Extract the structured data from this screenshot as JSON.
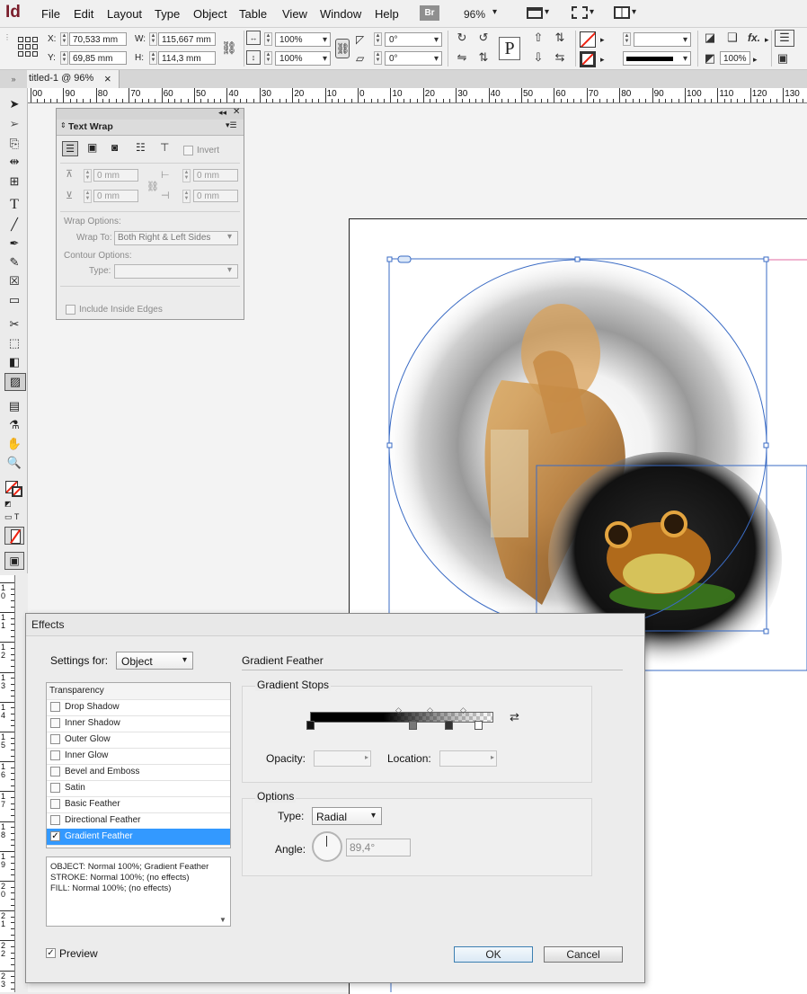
{
  "app": {
    "logo": "Id"
  },
  "menubar": {
    "items": [
      "File",
      "Edit",
      "Layout",
      "Type",
      "Object",
      "Table",
      "View",
      "Window",
      "Help"
    ],
    "bridge": "Br",
    "zoom": "96%"
  },
  "control": {
    "x_label": "X:",
    "x_value": "70,533 mm",
    "y_label": "Y:",
    "y_value": "69,85 mm",
    "w_label": "W:",
    "w_value": "115,667 mm",
    "h_label": "H:",
    "h_value": "114,3 mm",
    "scale_x": "100%",
    "scale_y": "100%",
    "rotate": "0°",
    "shear": "0°",
    "opacity": "100%"
  },
  "document": {
    "tab_title": "titled-1 @ 96%",
    "close": "×"
  },
  "ruler": {
    "h_labels": [
      "00",
      "90",
      "80",
      "70",
      "60",
      "50",
      "40",
      "30",
      "20",
      "10",
      "0",
      "10",
      "20",
      "30",
      "40",
      "50",
      "60",
      "70",
      "80",
      "90",
      "100",
      "110",
      "120",
      "130"
    ],
    "v_labels": [
      "1 0",
      "1 1",
      "1 2",
      "1 3",
      "1 4",
      "1 5",
      "1 6",
      "1 7",
      "1 8",
      "1 9",
      "2 0",
      "2 1",
      "2 2",
      "2 3"
    ]
  },
  "text_wrap": {
    "title": "Text Wrap",
    "invert": "Invert",
    "top_offset": "0 mm",
    "left_offset": "0 mm",
    "bottom_offset": "0 mm",
    "right_offset": "0 mm",
    "wrap_options": "Wrap Options:",
    "wrap_to_label": "Wrap To:",
    "wrap_to_value": "Both Right & Left Sides",
    "contour_options": "Contour Options:",
    "type_label": "Type:",
    "include_inside": "Include Inside Edges"
  },
  "effects": {
    "title": "Effects",
    "settings_for_label": "Settings for:",
    "settings_for_value": "Object",
    "list_header": "Transparency",
    "items": [
      {
        "label": "Drop Shadow",
        "checked": false
      },
      {
        "label": "Inner Shadow",
        "checked": false
      },
      {
        "label": "Outer Glow",
        "checked": false
      },
      {
        "label": "Inner Glow",
        "checked": false
      },
      {
        "label": "Bevel and Emboss",
        "checked": false
      },
      {
        "label": "Satin",
        "checked": false
      },
      {
        "label": "Basic Feather",
        "checked": false
      },
      {
        "label": "Directional Feather",
        "checked": false
      },
      {
        "label": "Gradient Feather",
        "checked": true
      }
    ],
    "summary": [
      "OBJECT: Normal 100%; Gradient Feather",
      "STROKE: Normal 100%; (no effects)",
      "FILL: Normal 100%; (no effects)"
    ],
    "section_title": "Gradient Feather",
    "stops_title": "Gradient Stops",
    "opacity_label": "Opacity:",
    "location_label": "Location:",
    "options_title": "Options",
    "type_label": "Type:",
    "type_value": "Radial",
    "angle_label": "Angle:",
    "angle_value": "89,4°",
    "preview_label": "Preview",
    "ok": "OK",
    "cancel": "Cancel"
  }
}
